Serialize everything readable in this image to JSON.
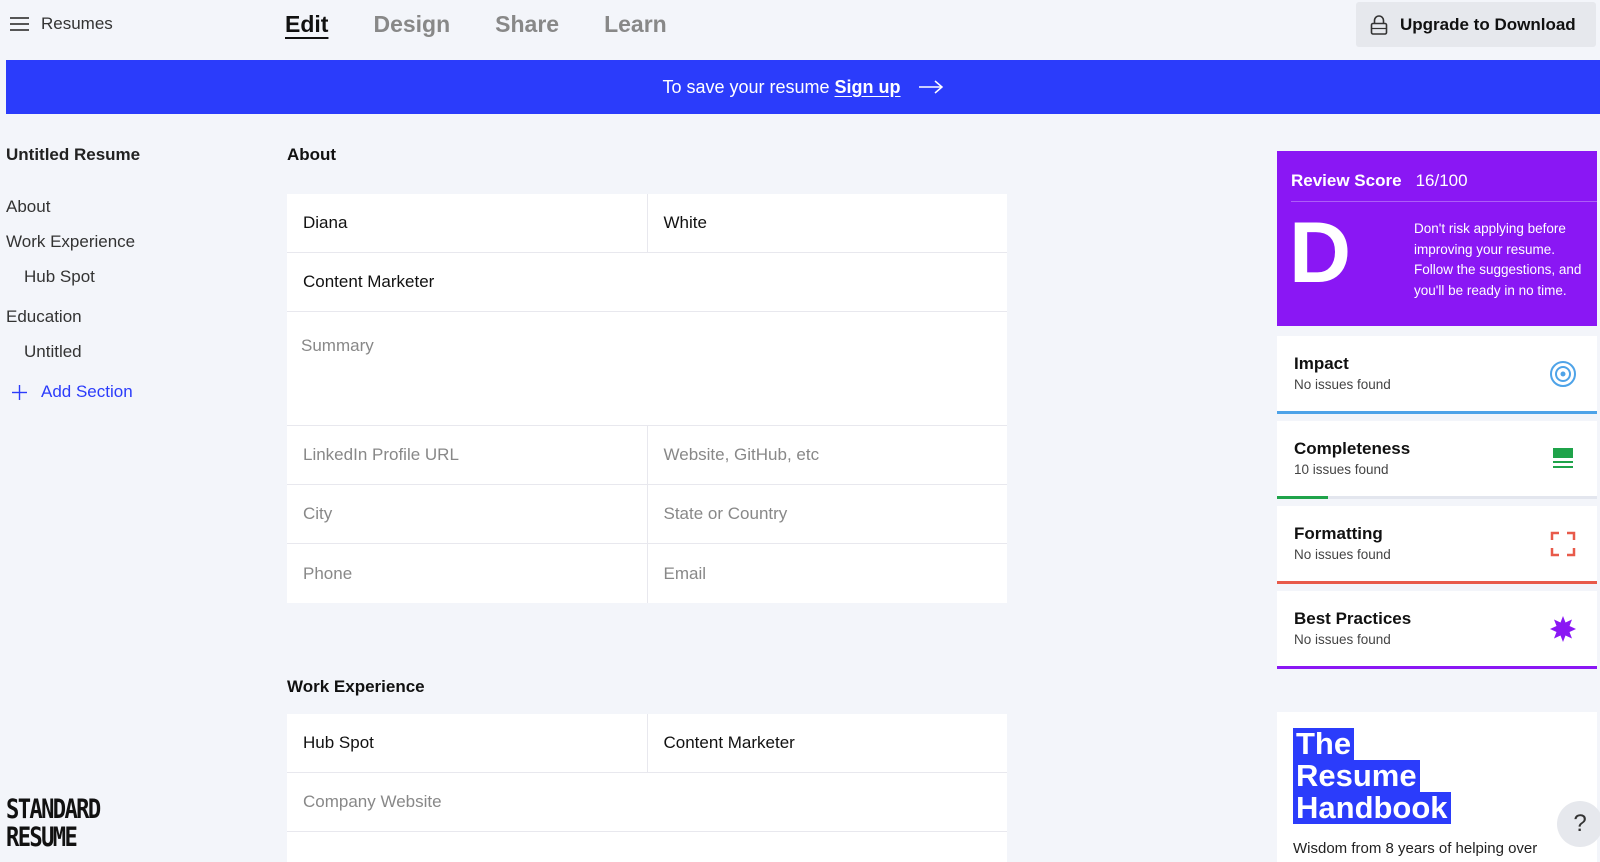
{
  "topbar": {
    "menu_label": "Resumes",
    "tabs": [
      {
        "label": "Edit",
        "active": true
      },
      {
        "label": "Design",
        "active": false
      },
      {
        "label": "Share",
        "active": false
      },
      {
        "label": "Learn",
        "active": false
      }
    ],
    "upgrade_label": "Upgrade to Download"
  },
  "banner": {
    "text": "To save your resume",
    "link": "Sign up"
  },
  "sidebar": {
    "title": "Untitled Resume",
    "items": [
      {
        "label": "About"
      },
      {
        "label": "Work Experience"
      },
      {
        "label": "Hub Spot"
      },
      {
        "label": "Education"
      },
      {
        "label": "Untitled"
      }
    ],
    "add_section": "Add Section",
    "logo_line1": "STANDARD",
    "logo_line2": "RESUME"
  },
  "about": {
    "title": "About",
    "first_name": "Diana",
    "last_name": "White",
    "job_title": "Content Marketer",
    "summary_placeholder": "Summary",
    "linkedin_placeholder": "LinkedIn Profile URL",
    "website_placeholder": "Website, GitHub, etc",
    "city_placeholder": "City",
    "state_placeholder": "State or Country",
    "phone_placeholder": "Phone",
    "email_placeholder": "Email"
  },
  "work": {
    "title": "Work Experience",
    "company": "Hub Spot",
    "position": "Content Marketer",
    "website_placeholder": "Company Website"
  },
  "review": {
    "label": "Review Score",
    "score": "16/100",
    "grade": "D",
    "message": "Don't risk applying before improving your resume. Follow the suggestions, and you'll be ready in no time.",
    "color": "#8a17f4"
  },
  "metrics": [
    {
      "name": "Impact",
      "status": "No issues found",
      "icon": "target-icon",
      "color": "#4ea3e8",
      "progress": 1.0
    },
    {
      "name": "Completeness",
      "status": "10 issues found",
      "icon": "list-icon",
      "color": "#1fa34a",
      "progress": 0.16
    },
    {
      "name": "Formatting",
      "status": "No issues found",
      "icon": "frame-corners-icon",
      "color": "#e85a4a",
      "progress": 1.0
    },
    {
      "name": "Best Practices",
      "status": "No issues found",
      "icon": "starburst-icon",
      "color": "#8a17f4",
      "progress": 1.0
    }
  ],
  "handbook": {
    "title_line1": "The",
    "title_line2": "Resume",
    "title_line3": "Handbook",
    "text": "Wisdom from 8 years of helping over"
  },
  "help_label": "?"
}
